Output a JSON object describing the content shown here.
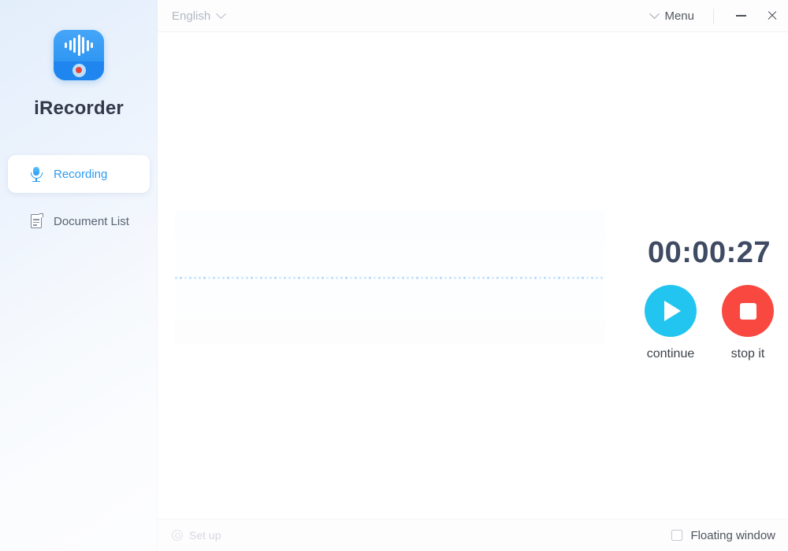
{
  "window": {
    "app_name": "iRecorder",
    "app_icon": "recorder-waveform-icon",
    "minimize_icon": "minimize-icon",
    "close_icon": "close-icon"
  },
  "topbar": {
    "language_label": "English",
    "language_chevron_icon": "chevron-down-icon",
    "menu_label": "Menu",
    "menu_chevron_icon": "chevron-down-icon"
  },
  "sidebar": {
    "title": "iRecorder",
    "items": [
      {
        "label": "Recording",
        "icon": "microphone-icon",
        "active": true
      },
      {
        "label": "Document List",
        "icon": "document-icon",
        "active": false
      }
    ]
  },
  "recorder": {
    "timer": "00:00:27",
    "waveform_state": "flat-silent",
    "controls": [
      {
        "label": "continue",
        "icon": "play-icon",
        "color": "#21c5ef"
      },
      {
        "label": "stop it",
        "icon": "stop-icon",
        "color": "#f9483f"
      }
    ]
  },
  "footer": {
    "setup_label": "Set up",
    "setup_icon": "gear-icon",
    "floating_window_label": "Floating window",
    "floating_window_checked": false
  },
  "colors": {
    "accent_blue": "#2f9bf0",
    "play_cyan": "#21c5ef",
    "stop_red": "#f9483f",
    "timer_text": "#3f4a63"
  }
}
